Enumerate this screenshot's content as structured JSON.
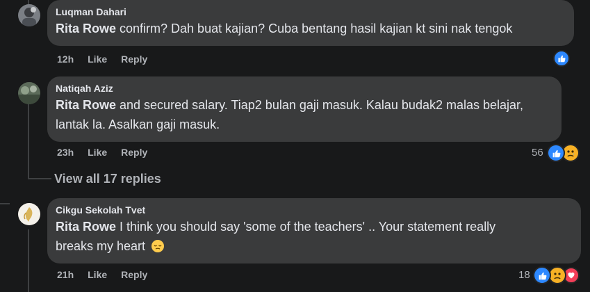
{
  "comments": [
    {
      "author": "Luqman Dahari",
      "mention": "Rita Rowe",
      "text_line1": " confirm? Dah buat kajian? Cuba bentang hasil kajian kt sini nak tengok",
      "time": "12h",
      "like_label": "Like",
      "reply_label": "Reply",
      "reaction_count": ""
    },
    {
      "author": "Natiqah Aziz",
      "mention": "Rita Rowe",
      "text_line1": " and secured salary. Tiap2 bulan gaji masuk. Kalau budak2 malas belajar,",
      "text_line2": "lantak la. Asalkan gaji masuk.",
      "time": "23h",
      "like_label": "Like",
      "reply_label": "Reply",
      "reaction_count": "56"
    },
    {
      "author": "Cikgu Sekolah Tvet",
      "mention": "Rita Rowe",
      "text_line1": " I think you should say 'some of the teachers' .. Your statement really",
      "text_line2": "breaks my heart",
      "time": "21h",
      "like_label": "Like",
      "reply_label": "Reply",
      "reaction_count": "18"
    }
  ],
  "view_replies_label": "View all 17 replies",
  "icons": {
    "like": "like-icon",
    "sad": "sad-icon",
    "love": "love-icon",
    "pensive": "pensive-emoji"
  },
  "colors": {
    "background": "#18191a",
    "bubble": "#3a3b3c",
    "like_blue": "#2d88ff",
    "love_red": "#f33e58",
    "sad_yellow": "#f7b125"
  }
}
